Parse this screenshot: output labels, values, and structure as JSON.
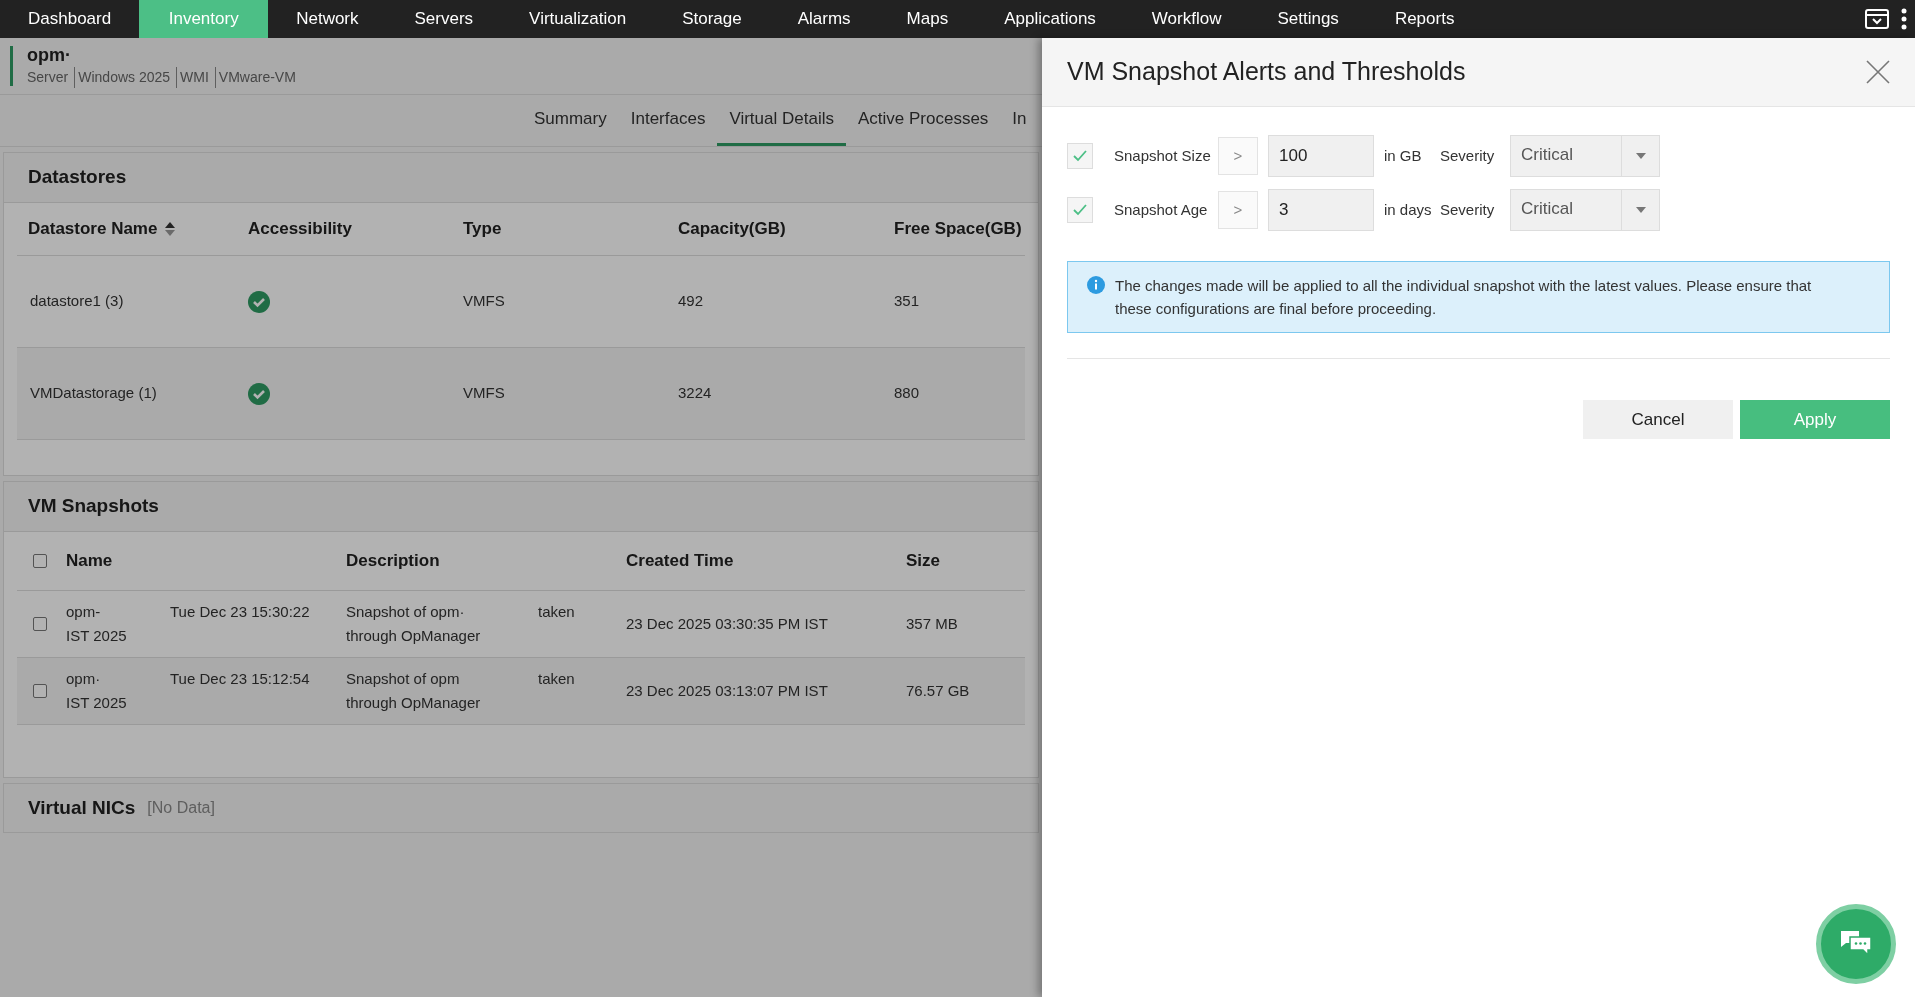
{
  "nav": {
    "items": [
      {
        "label": "Dashboard",
        "selected": false
      },
      {
        "label": "Inventory",
        "selected": true
      },
      {
        "label": "Network",
        "selected": false
      },
      {
        "label": "Servers",
        "selected": false
      },
      {
        "label": "Virtualization",
        "selected": false
      },
      {
        "label": "Storage",
        "selected": false
      },
      {
        "label": "Alarms",
        "selected": false
      },
      {
        "label": "Maps",
        "selected": false
      },
      {
        "label": "Applications",
        "selected": false
      },
      {
        "label": "Workflow",
        "selected": false
      },
      {
        "label": "Settings",
        "selected": false
      },
      {
        "label": "Reports",
        "selected": false
      }
    ]
  },
  "device": {
    "name": "opm·",
    "details": [
      "Server",
      "Windows 2025",
      "WMI",
      "VMware-VM"
    ]
  },
  "tabs": [
    {
      "label": "Summary",
      "selected": false
    },
    {
      "label": "Interfaces",
      "selected": false
    },
    {
      "label": "Virtual Details",
      "selected": true
    },
    {
      "label": "Active Processes",
      "selected": false
    },
    {
      "label": "In",
      "selected": false
    }
  ],
  "datastores": {
    "title": "Datastores",
    "columns": [
      "Datastore Name",
      "Accessibility",
      "Type",
      "Capacity(GB)",
      "Free Space(GB)"
    ],
    "rows": [
      {
        "name": "datastore1 (3)",
        "accessible": true,
        "type": "VMFS",
        "capacity": "492",
        "free": "351"
      },
      {
        "name": "VMDatastorage (1)",
        "accessible": true,
        "type": "VMFS",
        "capacity": "3224",
        "free": "880"
      }
    ]
  },
  "snapshots": {
    "title": "VM Snapshots",
    "select_all_checked": false,
    "columns": [
      "Name",
      "Description",
      "Created Time",
      "Size"
    ],
    "rows": [
      {
        "checked": false,
        "name": "opm-",
        "name_time": "Tue Dec 23 15:30:22",
        "name_tail": "IST 2025",
        "desc": "Snapshot of opm·",
        "desc_tail": "taken",
        "desc_line2": "through OpManager",
        "created": "23 Dec 2025 03:30:35 PM IST",
        "size": "357 MB"
      },
      {
        "checked": false,
        "name": "opm·",
        "name_time": "Tue Dec 23 15:12:54",
        "name_tail": "IST 2025",
        "desc": "Snapshot of opm",
        "desc_tail": "taken",
        "desc_line2": "through OpManager",
        "created": "23 Dec 2025 03:13:07 PM IST",
        "size": "76.57 GB"
      }
    ]
  },
  "nics": {
    "title": "Virtual NICs",
    "note": "[No Data]"
  },
  "panel": {
    "title": "VM Snapshot Alerts and Thresholds",
    "rules": [
      {
        "checked": true,
        "label": "Snapshot Size",
        "operator": ">",
        "value": "100",
        "unit": "in GB",
        "severity_label": "Severity",
        "severity": "Critical"
      },
      {
        "checked": true,
        "label": "Snapshot Age",
        "operator": ">",
        "value": "3",
        "unit": "in days",
        "severity_label": "Severity",
        "severity": "Critical"
      }
    ],
    "info": "The changes made will be applied to all the individual snapshot with the latest values. Please ensure that these configurations are final before proceeding.",
    "buttons": [
      "Cancel",
      "Apply"
    ]
  }
}
